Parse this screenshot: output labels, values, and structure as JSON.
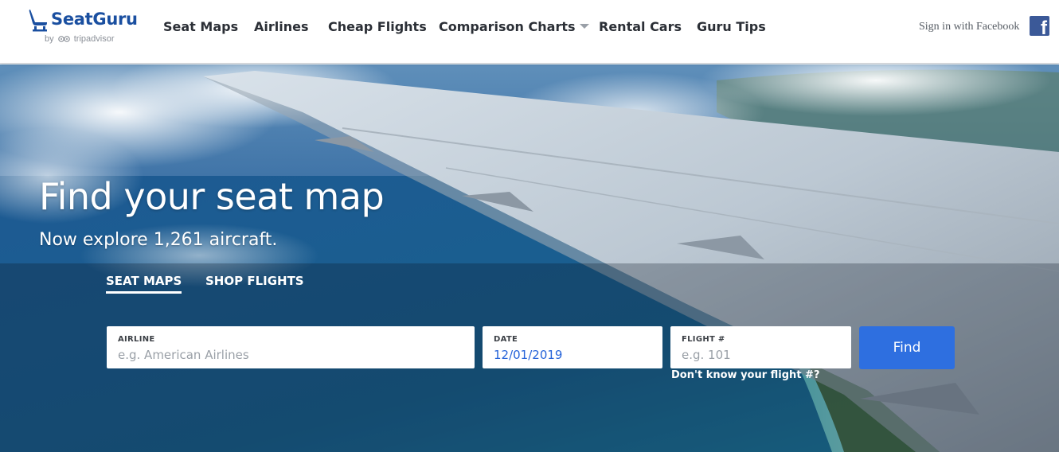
{
  "header": {
    "logo": {
      "brand": "SeatGuru",
      "byline_prefix": "by",
      "byline_brand": "tripadvisor"
    },
    "nav": [
      {
        "label": "Seat Maps"
      },
      {
        "label": "Airlines"
      },
      {
        "label": "Cheap Flights"
      },
      {
        "label": "Comparison Charts",
        "has_dropdown": true
      },
      {
        "label": "Rental Cars"
      },
      {
        "label": "Guru Tips"
      }
    ],
    "facebook": {
      "signin_label": "Sign in with Facebook",
      "icon_glyph": "f",
      "color": "#3b5998"
    }
  },
  "hero": {
    "title": "Find your seat map",
    "subtitle": "Now explore 1,261 aircraft.",
    "tabs": [
      {
        "label": "SEAT MAPS",
        "active": true
      },
      {
        "label": "SHOP FLIGHTS",
        "active": false
      }
    ],
    "search": {
      "airline": {
        "label": "AIRLINE",
        "placeholder": "e.g. American Airlines",
        "value": ""
      },
      "date": {
        "label": "DATE",
        "value": "12/01/2019"
      },
      "flight": {
        "label": "FLIGHT #",
        "placeholder": "e.g. 101",
        "value": ""
      },
      "find_label": "Find",
      "help_link": "Don't know your flight #?"
    }
  },
  "colors": {
    "brand_blue": "#1a4fa0",
    "find_button": "#2e6fe0",
    "date_text": "#2563d9",
    "nav_text": "#2b2f36"
  }
}
